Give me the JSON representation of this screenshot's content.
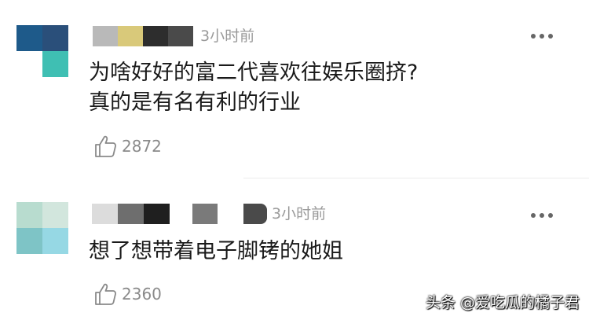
{
  "comments": [
    {
      "time": "3小时前",
      "lines": [
        "为啥好好的富二代喜欢往娱乐圈挤?",
        "真的是有名有利的行业"
      ],
      "likes": "2872"
    },
    {
      "time": "3小时前",
      "lines": [
        "想了想带着电子脚铐的她姐"
      ],
      "likes": "2360"
    }
  ],
  "icons": {
    "more": "more-options-icon",
    "like": "thumbs-up-icon"
  },
  "watermark": "头条 @爱吃瓜的橘子君"
}
